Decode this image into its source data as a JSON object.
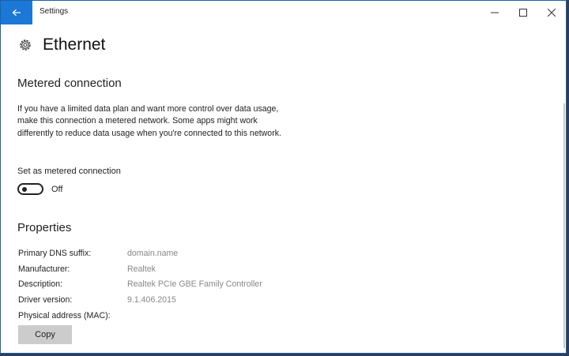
{
  "window": {
    "title": "Settings",
    "controls": [
      "minimize-icon",
      "maximize-icon",
      "close-icon"
    ]
  },
  "page": {
    "icon": "gear-icon",
    "title": "Ethernet"
  },
  "metered": {
    "heading": "Metered connection",
    "description": "If you have a limited data plan and want more control over data usage, make this connection a metered network. Some apps might work differently to reduce data usage when you're connected to this network.",
    "toggle_label": "Set as metered connection",
    "toggle_state": "Off",
    "toggle_on": false
  },
  "properties": {
    "heading": "Properties",
    "rows": [
      {
        "label": "Primary DNS suffix:",
        "value": "domain.name"
      },
      {
        "label": "Manufacturer:",
        "value": "Realtek"
      },
      {
        "label": "Description:",
        "value": "Realtek PCIe GBE Family Controller"
      },
      {
        "label": "Driver version:",
        "value": "9.1.406.2015"
      },
      {
        "label": "Physical address (MAC):",
        "value": ""
      }
    ],
    "copy_label": "Copy"
  },
  "colors": {
    "accent": "#1b78d6",
    "button_bg": "#cccccc"
  }
}
